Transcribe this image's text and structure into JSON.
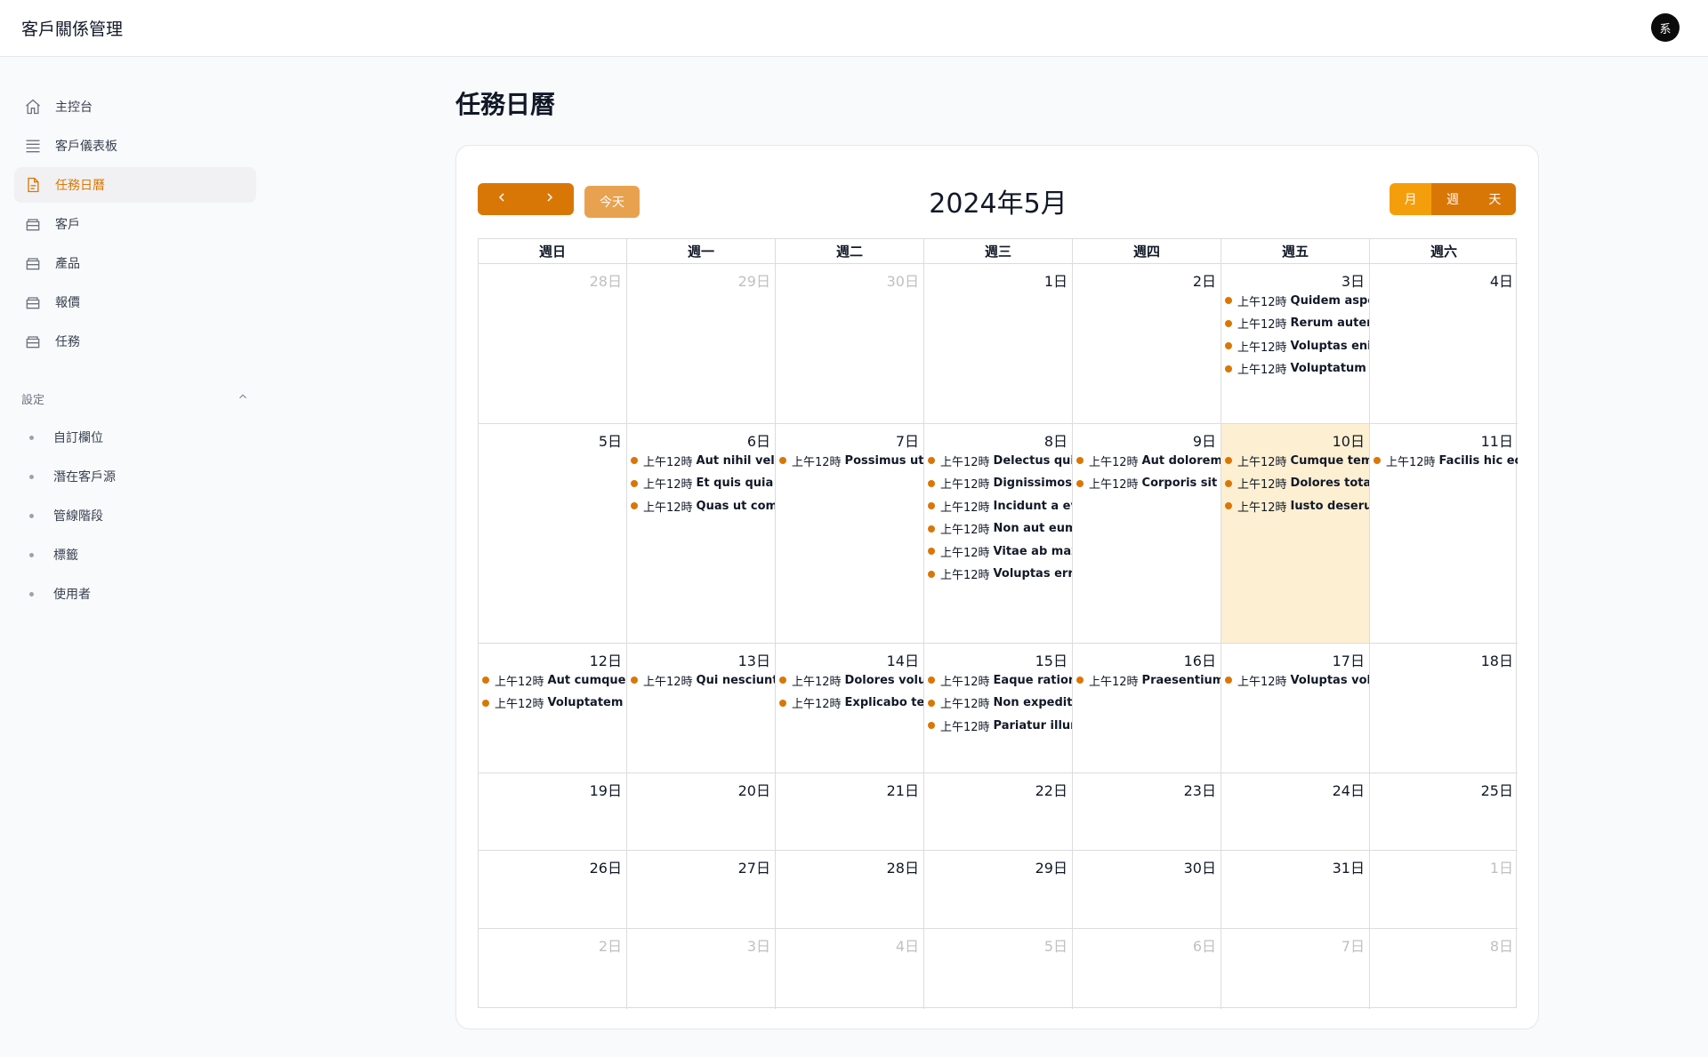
{
  "app": {
    "title": "客戶關係管理",
    "avatar_text": "系"
  },
  "sidebar": {
    "items": [
      {
        "label": "主控台",
        "icon": "home-icon",
        "active": false
      },
      {
        "label": "客戶儀表板",
        "icon": "table-icon",
        "active": false
      },
      {
        "label": "任務日曆",
        "icon": "document-icon",
        "active": true
      },
      {
        "label": "客戶",
        "icon": "folder-icon",
        "active": false
      },
      {
        "label": "產品",
        "icon": "folder-icon",
        "active": false
      },
      {
        "label": "報價",
        "icon": "folder-icon",
        "active": false
      },
      {
        "label": "任務",
        "icon": "folder-icon",
        "active": false
      }
    ],
    "settings_label": "設定",
    "settings_items": [
      "自訂欄位",
      "潛在客戶源",
      "管線階段",
      "標籤",
      "使用者"
    ]
  },
  "page": {
    "title": "任務日曆"
  },
  "calendar": {
    "title": "2024年5月",
    "today_label": "今天",
    "view_buttons": [
      {
        "label": "月",
        "active": true
      },
      {
        "label": "週",
        "active": false
      },
      {
        "label": "天",
        "active": false
      }
    ],
    "weekdays": [
      "週日",
      "週一",
      "週二",
      "週三",
      "週四",
      "週五",
      "週六"
    ],
    "weeks": [
      [
        {
          "day": "28日",
          "other": true,
          "events": []
        },
        {
          "day": "29日",
          "other": true,
          "events": []
        },
        {
          "day": "30日",
          "other": true,
          "events": []
        },
        {
          "day": "1日",
          "events": []
        },
        {
          "day": "2日",
          "events": []
        },
        {
          "day": "3日",
          "events": [
            {
              "time": "上午12時",
              "title": "Quidem asperiores"
            },
            {
              "time": "上午12時",
              "title": "Rerum autem"
            },
            {
              "time": "上午12時",
              "title": "Voluptas enim"
            },
            {
              "time": "上午12時",
              "title": "Voluptatum"
            }
          ]
        },
        {
          "day": "4日",
          "events": []
        }
      ],
      [
        {
          "day": "5日",
          "events": []
        },
        {
          "day": "6日",
          "events": [
            {
              "time": "上午12時",
              "title": "Aut nihil vel est"
            },
            {
              "time": "上午12時",
              "title": "Et quis quia nam"
            },
            {
              "time": "上午12時",
              "title": "Quas ut commodi"
            }
          ]
        },
        {
          "day": "7日",
          "events": [
            {
              "time": "上午12時",
              "title": "Possimus ut quis"
            }
          ]
        },
        {
          "day": "8日",
          "events": [
            {
              "time": "上午12時",
              "title": "Delectus quis"
            },
            {
              "time": "上午12時",
              "title": "Dignissimos"
            },
            {
              "time": "上午12時",
              "title": "Incidunt a eveniet"
            },
            {
              "time": "上午12時",
              "title": "Non aut eum"
            },
            {
              "time": "上午12時",
              "title": "Vitae ab maxime"
            },
            {
              "time": "上午12時",
              "title": "Voluptas error"
            }
          ]
        },
        {
          "day": "9日",
          "events": [
            {
              "time": "上午12時",
              "title": "Aut dolorem quia"
            },
            {
              "time": "上午12時",
              "title": "Corporis sit id"
            }
          ]
        },
        {
          "day": "10日",
          "today": true,
          "events": [
            {
              "time": "上午12時",
              "title": "Cumque tempore"
            },
            {
              "time": "上午12時",
              "title": "Dolores totam"
            },
            {
              "time": "上午12時",
              "title": "Iusto deserunt"
            }
          ]
        },
        {
          "day": "11日",
          "events": [
            {
              "time": "上午12時",
              "title": "Facilis hic eos"
            }
          ]
        }
      ],
      [
        {
          "day": "12日",
          "events": [
            {
              "time": "上午12時",
              "title": "Aut cumque et"
            },
            {
              "time": "上午12時",
              "title": "Voluptatem vel"
            }
          ]
        },
        {
          "day": "13日",
          "events": [
            {
              "time": "上午12時",
              "title": "Qui nesciunt"
            }
          ]
        },
        {
          "day": "14日",
          "events": [
            {
              "time": "上午12時",
              "title": "Dolores voluptas"
            },
            {
              "time": "上午12時",
              "title": "Explicabo tenetur"
            }
          ]
        },
        {
          "day": "15日",
          "events": [
            {
              "time": "上午12時",
              "title": "Eaque ratione"
            },
            {
              "time": "上午12時",
              "title": "Non expedita"
            },
            {
              "time": "上午12時",
              "title": "Pariatur illum"
            }
          ]
        },
        {
          "day": "16日",
          "events": [
            {
              "time": "上午12時",
              "title": "Praesentium"
            }
          ]
        },
        {
          "day": "17日",
          "events": [
            {
              "time": "上午12時",
              "title": "Voluptas voluptas"
            }
          ]
        },
        {
          "day": "18日",
          "events": []
        }
      ],
      [
        {
          "day": "19日",
          "events": []
        },
        {
          "day": "20日",
          "events": []
        },
        {
          "day": "21日",
          "events": []
        },
        {
          "day": "22日",
          "events": []
        },
        {
          "day": "23日",
          "events": []
        },
        {
          "day": "24日",
          "events": []
        },
        {
          "day": "25日",
          "events": []
        }
      ],
      [
        {
          "day": "26日",
          "events": []
        },
        {
          "day": "27日",
          "events": []
        },
        {
          "day": "28日",
          "events": []
        },
        {
          "day": "29日",
          "events": []
        },
        {
          "day": "30日",
          "events": []
        },
        {
          "day": "31日",
          "events": []
        },
        {
          "day": "1日",
          "other": true,
          "events": []
        }
      ],
      [
        {
          "day": "2日",
          "other": true,
          "events": []
        },
        {
          "day": "3日",
          "other": true,
          "events": []
        },
        {
          "day": "4日",
          "other": true,
          "events": []
        },
        {
          "day": "5日",
          "other": true,
          "events": []
        },
        {
          "day": "6日",
          "other": true,
          "events": []
        },
        {
          "day": "7日",
          "other": true,
          "events": []
        },
        {
          "day": "8日",
          "other": true,
          "events": []
        }
      ]
    ]
  },
  "colors": {
    "accent": "#d97706",
    "today_bg": "#fdefd2"
  }
}
